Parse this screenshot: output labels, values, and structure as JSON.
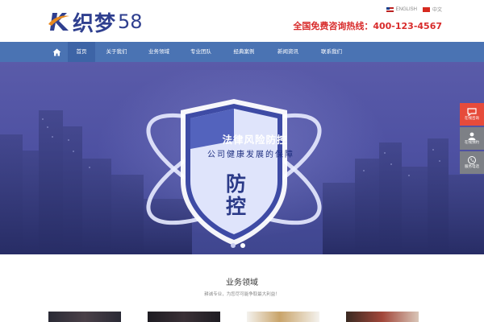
{
  "header": {
    "logo_text": "织梦",
    "logo_number": "58",
    "lang_en": "ENGLISH",
    "lang_cn": "中文",
    "hotline": "全国免费咨询热线：400-123-4567"
  },
  "nav": {
    "items": [
      {
        "label": "首页",
        "active": true
      },
      {
        "label": "关于我们"
      },
      {
        "label": "业务领域"
      },
      {
        "label": "专业团队"
      },
      {
        "label": "经典案例"
      },
      {
        "label": "新闻资讯"
      },
      {
        "label": "联系我们"
      }
    ]
  },
  "banner": {
    "headline": "法律风险防控",
    "subheadline": "公司健康发展的保障",
    "big_char_1": "防",
    "big_char_2": "控"
  },
  "float_buttons": {
    "online_consult": "在线咨询",
    "online_booking": "在线预约",
    "service_phone": "服务电话"
  },
  "section": {
    "title": "业务领域",
    "subtitle": "耕诚专业，为您尽可能争取最大利益！"
  },
  "colors": {
    "nav_bg": "#4a73b3",
    "hotline_red": "#d82b2b",
    "logo_blue": "#2f3f8f",
    "banner_blue": "#4e51a2",
    "float_red": "#e64b3b"
  }
}
